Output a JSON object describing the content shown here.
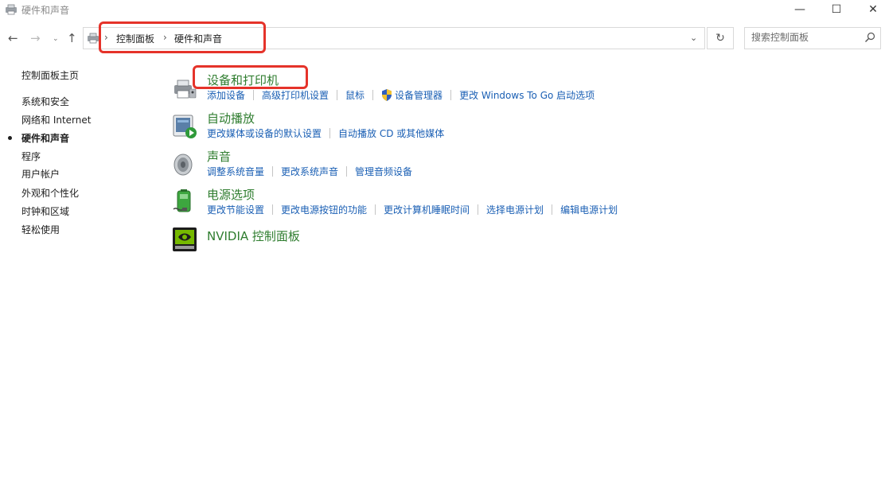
{
  "window": {
    "title": "硬件和声音",
    "minimize_glyph": "—",
    "maximize_glyph": "☐",
    "close_glyph": "✕"
  },
  "nav": {
    "back_glyph": "←",
    "forward_glyph": "→",
    "recent_glyph": "⌄",
    "up_glyph": "↑",
    "refresh_glyph": "↻",
    "dropdown_glyph": "⌄"
  },
  "address": {
    "separator": "›",
    "crumbs": [
      "控制面板",
      "硬件和声音"
    ]
  },
  "search": {
    "placeholder": "搜索控制面板"
  },
  "sidebar": {
    "items": [
      {
        "label": "控制面板主页",
        "current": false
      },
      {
        "label": "系统和安全",
        "current": false
      },
      {
        "label": "网络和 Internet",
        "current": false
      },
      {
        "label": "硬件和声音",
        "current": true
      },
      {
        "label": "程序",
        "current": false
      },
      {
        "label": "用户帐户",
        "current": false
      },
      {
        "label": "外观和个性化",
        "current": false
      },
      {
        "label": "时钟和区域",
        "current": false
      },
      {
        "label": "轻松使用",
        "current": false
      }
    ]
  },
  "categories": [
    {
      "title": "设备和打印机",
      "icon": "printer-icon",
      "links": [
        "添加设备",
        "高级打印机设置",
        "鼠标",
        "设备管理器",
        "更改 Windows To Go 启动选项"
      ]
    },
    {
      "title": "自动播放",
      "icon": "autoplay-icon",
      "links": [
        "更改媒体或设备的默认设置",
        "自动播放 CD 或其他媒体"
      ]
    },
    {
      "title": "声音",
      "icon": "speaker-icon",
      "links": [
        "调整系统音量",
        "更改系统声音",
        "管理音频设备"
      ]
    },
    {
      "title": "电源选项",
      "icon": "battery-icon",
      "links": [
        "更改节能设置",
        "更改电源按钮的功能",
        "更改计算机睡眠时间",
        "选择电源计划",
        "编辑电源计划"
      ]
    },
    {
      "title": "NVIDIA 控制面板",
      "icon": "nvidia-icon",
      "links": []
    }
  ],
  "colors": {
    "category_title": "#2f7d2f",
    "link": "#1a5fb4",
    "annotation_red": "#e5332a"
  }
}
